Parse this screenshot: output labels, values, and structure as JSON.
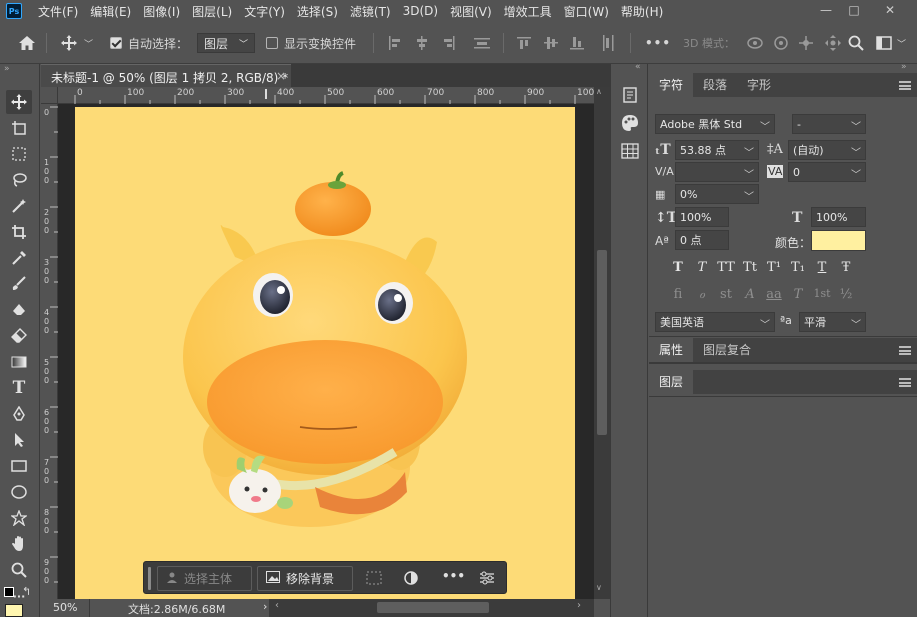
{
  "app": {
    "logo": "Ps"
  },
  "menubar": {
    "items": [
      "文件(F)",
      "编辑(E)",
      "图像(I)",
      "图层(L)",
      "文字(Y)",
      "选择(S)",
      "滤镜(T)",
      "3D(D)",
      "视图(V)",
      "增效工具",
      "窗口(W)",
      "帮助(H)"
    ],
    "window_controls": [
      "—",
      "□",
      "✕"
    ]
  },
  "optionsbar": {
    "auto_select_label": "自动选择：",
    "auto_select_checked": true,
    "auto_select_target": "图层",
    "show_transform_label": "显示变换控件",
    "show_transform_checked": false,
    "more_label": "•••",
    "mode_3d_label": "3D 模式："
  },
  "document": {
    "tab_title": "未标题-1 @ 50% (图层 1 拷贝 2, RGB/8) *",
    "close_symbol": "×",
    "ruler_top": [
      "0",
      "100",
      "200",
      "300",
      "400",
      "500",
      "600",
      "700",
      "800",
      "900",
      "100"
    ],
    "ruler_left": [
      "0",
      "1",
      "0",
      "0",
      "2",
      "0",
      "0",
      "3",
      "0",
      "0",
      "4",
      "0",
      "0",
      "5",
      "0",
      "0",
      "6",
      "0",
      "0",
      "7",
      "0",
      "0",
      "8",
      "0",
      "0",
      "9",
      "0",
      "0"
    ],
    "canvas_color": "#fddb77",
    "zoom": "50%",
    "doc_size": "文档:2.86M/6.68M"
  },
  "taskbar": {
    "select_subject": "选择主体",
    "remove_bg": "移除背景",
    "more": "•••"
  },
  "character_panel": {
    "tabs": [
      "字符",
      "段落",
      "字形"
    ],
    "active_tab": "字符",
    "font_family": "Adobe 黑体 Std",
    "font_style": "-",
    "font_size": "53.88 点",
    "leading": "(自动)",
    "kerning": "",
    "tracking": "0",
    "scale_tsume": "0%",
    "vertical_scale": "100%",
    "horizontal_scale": "100%",
    "baseline_shift": "0 点",
    "color_label": "颜色：",
    "color_value": "#fff0a0",
    "style_glyphs": [
      "T",
      "T",
      "TT",
      "Tt",
      "T¹",
      "T₁",
      "T",
      "Ŧ"
    ],
    "opentype_glyphs": [
      "fi",
      "ℴ",
      "st",
      "A",
      "aa",
      "T",
      "1st",
      "½"
    ],
    "language": "美国英语",
    "aa_label": "ªa",
    "antialias": "平滑"
  },
  "properties_panel": {
    "tabs": [
      "属性",
      "图层复合"
    ]
  },
  "layers_panel": {
    "tabs": [
      "图层"
    ]
  },
  "colors": {
    "fg": "#000000",
    "bg": "#ffffff",
    "swatch_yellow": "#fff6b0"
  }
}
